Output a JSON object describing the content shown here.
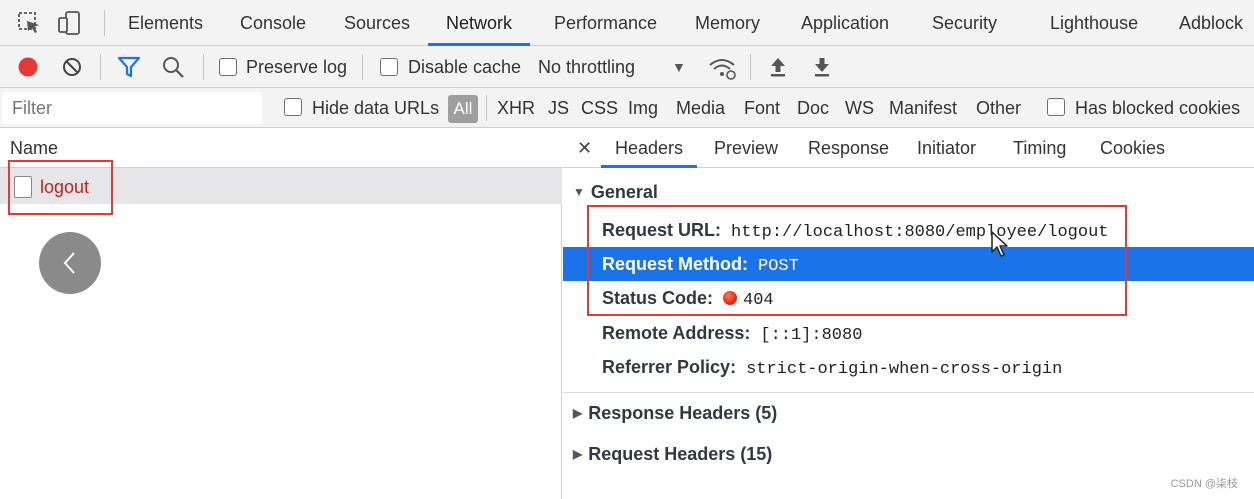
{
  "tabs": [
    {
      "label": "Elements"
    },
    {
      "label": "Console"
    },
    {
      "label": "Sources"
    },
    {
      "label": "Network",
      "active": true
    },
    {
      "label": "Performance"
    },
    {
      "label": "Memory"
    },
    {
      "label": "Application"
    },
    {
      "label": "Security"
    },
    {
      "label": "Lighthouse"
    },
    {
      "label": "Adblock"
    }
  ],
  "toolbar": {
    "preserve_log": "Preserve log",
    "disable_cache": "Disable cache",
    "throttling": "No throttling"
  },
  "filter": {
    "placeholder": "Filter",
    "hide_data_urls": "Hide data URLs",
    "all": "All",
    "types": [
      "XHR",
      "JS",
      "CSS",
      "Img",
      "Media",
      "Font",
      "Doc",
      "WS",
      "Manifest",
      "Other"
    ],
    "has_blocked_cookies": "Has blocked cookies"
  },
  "requests": {
    "column_name": "Name",
    "items": [
      {
        "name": "logout"
      }
    ]
  },
  "details": {
    "tabs": [
      "Headers",
      "Preview",
      "Response",
      "Initiator",
      "Timing",
      "Cookies"
    ],
    "active_tab": "Headers",
    "general": {
      "title": "General",
      "request_url_label": "Request URL:",
      "request_url": "http://localhost:8080/employee/logout",
      "request_method_label": "Request Method:",
      "request_method": "POST",
      "status_code_label": "Status Code:",
      "status_code": "404",
      "remote_address_label": "Remote Address:",
      "remote_address": "[::1]:8080",
      "referrer_policy_label": "Referrer Policy:",
      "referrer_policy": "strict-origin-when-cross-origin"
    },
    "response_headers": "Response Headers (5)",
    "request_headers": "Request Headers (15)"
  },
  "watermark": "CSDN @柒枝",
  "colors": {
    "accent": "#1a73e8",
    "record": "#e53935",
    "highlight_box": "#e53935",
    "error_text": "#c5221f"
  }
}
